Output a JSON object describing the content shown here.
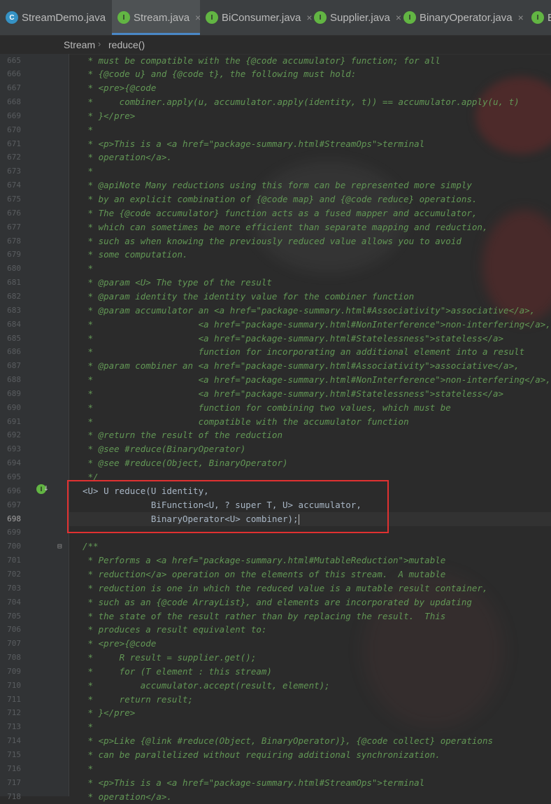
{
  "tabs": [
    {
      "label": "StreamDemo.java",
      "icon": "class-icon",
      "active": false
    },
    {
      "label": "Stream.java",
      "icon": "interface-icon",
      "active": true
    },
    {
      "label": "BiConsumer.java",
      "icon": "interface-icon",
      "active": false
    },
    {
      "label": "Supplier.java",
      "icon": "interface-icon",
      "active": false
    },
    {
      "label": "BinaryOperator.java",
      "icon": "interface-icon",
      "active": false
    },
    {
      "label": "Bi",
      "icon": "interface-icon",
      "active": false
    }
  ],
  "close_glyph": "×",
  "breadcrumb": [
    "Stream",
    "reduce()"
  ],
  "editor": {
    "current_line": "698",
    "lines": [
      {
        "n": "665",
        "t": " * must be compatible with the {@code accumulator} function; for all"
      },
      {
        "n": "666",
        "t": " * {@code u} and {@code t}, the following must hold:"
      },
      {
        "n": "667",
        "t": " * <pre>{@code"
      },
      {
        "n": "668",
        "t": " *     combiner.apply(u, accumulator.apply(identity, t)) == accumulator.apply(u, t)"
      },
      {
        "n": "669",
        "t": " * }</pre>"
      },
      {
        "n": "670",
        "t": " *"
      },
      {
        "n": "671",
        "t": " * <p>This is a <a href=\"package-summary.html#StreamOps\">terminal"
      },
      {
        "n": "672",
        "t": " * operation</a>."
      },
      {
        "n": "673",
        "t": " *"
      },
      {
        "n": "674",
        "t": " * @apiNote Many reductions using this form can be represented more simply"
      },
      {
        "n": "675",
        "t": " * by an explicit combination of {@code map} and {@code reduce} operations."
      },
      {
        "n": "676",
        "t": " * The {@code accumulator} function acts as a fused mapper and accumulator,"
      },
      {
        "n": "677",
        "t": " * which can sometimes be more efficient than separate mapping and reduction,"
      },
      {
        "n": "678",
        "t": " * such as when knowing the previously reduced value allows you to avoid"
      },
      {
        "n": "679",
        "t": " * some computation."
      },
      {
        "n": "680",
        "t": " *"
      },
      {
        "n": "681",
        "t": " * @param <U> The type of the result"
      },
      {
        "n": "682",
        "t": " * @param identity the identity value for the combiner function"
      },
      {
        "n": "683",
        "t": " * @param accumulator an <a href=\"package-summary.html#Associativity\">associative</a>,"
      },
      {
        "n": "684",
        "t": " *                    <a href=\"package-summary.html#NonInterference\">non-interfering</a>,"
      },
      {
        "n": "685",
        "t": " *                    <a href=\"package-summary.html#Statelessness\">stateless</a>"
      },
      {
        "n": "686",
        "t": " *                    function for incorporating an additional element into a result"
      },
      {
        "n": "687",
        "t": " * @param combiner an <a href=\"package-summary.html#Associativity\">associative</a>,"
      },
      {
        "n": "688",
        "t": " *                    <a href=\"package-summary.html#NonInterference\">non-interfering</a>,"
      },
      {
        "n": "689",
        "t": " *                    <a href=\"package-summary.html#Statelessness\">stateless</a>"
      },
      {
        "n": "690",
        "t": " *                    function for combining two values, which must be"
      },
      {
        "n": "691",
        "t": " *                    compatible with the accumulator function"
      },
      {
        "n": "692",
        "t": " * @return the result of the reduction"
      },
      {
        "n": "693",
        "t": " * @see #reduce(BinaryOperator)"
      },
      {
        "n": "694",
        "t": " * @see #reduce(Object, BinaryOperator)"
      },
      {
        "n": "695",
        "t": " */"
      },
      {
        "n": "696",
        "t": "<U> U reduce(U identity,",
        "decl": true
      },
      {
        "n": "697",
        "t": "             BiFunction<U, ? super T, U> accumulator,",
        "decl": true
      },
      {
        "n": "698",
        "t": "             BinaryOperator<U> combiner);",
        "decl": true
      },
      {
        "n": "699",
        "t": ""
      },
      {
        "n": "700",
        "t": "/**"
      },
      {
        "n": "701",
        "t": " * Performs a <a href=\"package-summary.html#MutableReduction\">mutable"
      },
      {
        "n": "702",
        "t": " * reduction</a> operation on the elements of this stream.  A mutable"
      },
      {
        "n": "703",
        "t": " * reduction is one in which the reduced value is a mutable result container,"
      },
      {
        "n": "704",
        "t": " * such as an {@code ArrayList}, and elements are incorporated by updating"
      },
      {
        "n": "705",
        "t": " * the state of the result rather than by replacing the result.  This"
      },
      {
        "n": "706",
        "t": " * produces a result equivalent to:"
      },
      {
        "n": "707",
        "t": " * <pre>{@code"
      },
      {
        "n": "708",
        "t": " *     R result = supplier.get();"
      },
      {
        "n": "709",
        "t": " *     for (T element : this stream)"
      },
      {
        "n": "710",
        "t": " *         accumulator.accept(result, element);"
      },
      {
        "n": "711",
        "t": " *     return result;"
      },
      {
        "n": "712",
        "t": " * }</pre>"
      },
      {
        "n": "713",
        "t": " *"
      },
      {
        "n": "714",
        "t": " * <p>Like {@link #reduce(Object, BinaryOperator)}, {@code collect} operations"
      },
      {
        "n": "715",
        "t": " * can be parallelized without requiring additional synchronization."
      },
      {
        "n": "716",
        "t": " *"
      },
      {
        "n": "717",
        "t": " * <p>This is a <a href=\"package-summary.html#StreamOps\">terminal"
      },
      {
        "n": "718",
        "t": " * operation</a>."
      }
    ]
  },
  "gutter_marker": {
    "letter": "I",
    "arrow": "↓"
  },
  "colors": {
    "editor_bg": "#2b2b2b",
    "doc_comment": "#629755",
    "code_text": "#a9b7c6",
    "highlight_box": "#e03131",
    "active_tab_underline": "#4a88c7"
  }
}
